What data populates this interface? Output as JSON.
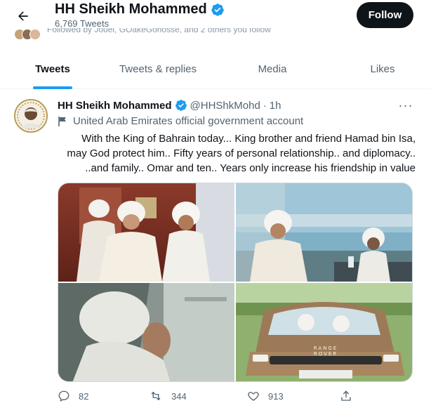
{
  "header": {
    "back_label": "←",
    "profile_name": "HH Sheikh Mohammed",
    "tweet_count": "6,769 Tweets",
    "follow_label": "Follow",
    "followed_by": "Followed by Jouel, GOakeGohosse, and 2 others you follow"
  },
  "tabs": [
    {
      "label": "Tweets",
      "active": true
    },
    {
      "label": "Tweets & replies",
      "active": false
    },
    {
      "label": "Media",
      "active": false
    },
    {
      "label": "Likes",
      "active": false
    }
  ],
  "tweet": {
    "author": "HH Sheikh Mohammed",
    "handle": "@HHShkMohd",
    "separator": "·",
    "time": "1h",
    "more_label": "···",
    "gov_label": "United Arab Emirates official government account",
    "text_lines": [
      "With the King of Bahrain today... King brother and friend Hamad bin Isa,",
      "may God protect him.. Fifty years of personal relationship.. and diplomacy..",
      "..and family.. Omar and ten.. Years only increase his friendship in value"
    ],
    "images": [
      {
        "description": "men in white at an event"
      },
      {
        "description": "seated at a racecourse"
      },
      {
        "description": "driving in a car"
      },
      {
        "description": "range rover with two men"
      }
    ],
    "car_badge": "RANGE ROVER",
    "actions": {
      "replies": "82",
      "retweets": "344",
      "likes": "913"
    }
  },
  "colors": {
    "accent": "#1d9bf0",
    "text": "#0f1419",
    "muted": "#536471",
    "verified": "#1d9bf0"
  }
}
